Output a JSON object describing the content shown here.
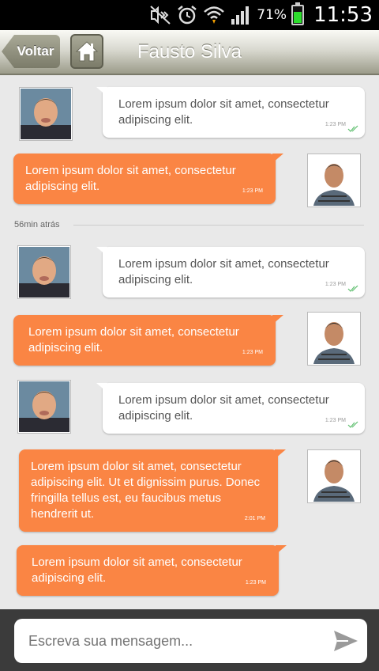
{
  "status_bar": {
    "battery_percent": "71%",
    "battery_level": 0.71,
    "time": "11:53",
    "icons": [
      "mute-icon",
      "alarm-icon",
      "wifi-icon",
      "signal-icon",
      "battery-icon"
    ]
  },
  "header": {
    "back_label": "Voltar",
    "title": "Fausto Silva",
    "home_icon": "home-icon"
  },
  "messages": [
    {
      "side": "in",
      "text": "Lorem ipsum dolor sit amet, consectetur adipiscing elit.",
      "time": "1:23 PM",
      "read": true
    },
    {
      "side": "out",
      "text": "Lorem ipsum dolor sit amet, consectetur adipiscing elit.",
      "time": "1:23 PM"
    },
    {
      "side": "in",
      "text": "Lorem ipsum dolor sit amet, consectetur adipiscing elit.",
      "time": "1:23 PM",
      "read": true
    },
    {
      "side": "out",
      "text": "Lorem ipsum dolor sit amet, consectetur adipiscing elit.",
      "time": "1:23 PM"
    },
    {
      "side": "in",
      "text": "Lorem ipsum dolor sit amet, consectetur adipiscing elit.",
      "time": "1:23 PM",
      "read": true
    },
    {
      "side": "out",
      "text": "Lorem ipsum dolor sit amet, consectetur adipiscing elit. Ut et dignissim purus. Donec fringilla tellus est, eu faucibus metus hendrerit ut.",
      "time": "2:01 PM"
    },
    {
      "side": "out",
      "text": "Lorem ipsum dolor sit amet, consectetur adipiscing elit.",
      "time": "1:23 PM"
    }
  ],
  "separator": {
    "label": "56min atrás"
  },
  "composer": {
    "placeholder": "Escreva sua mensagem...",
    "send_icon": "send-icon"
  },
  "colors": {
    "outgoing_bubble": "#fa8544",
    "incoming_bubble": "#ffffff",
    "background": "#e9e9e9"
  }
}
